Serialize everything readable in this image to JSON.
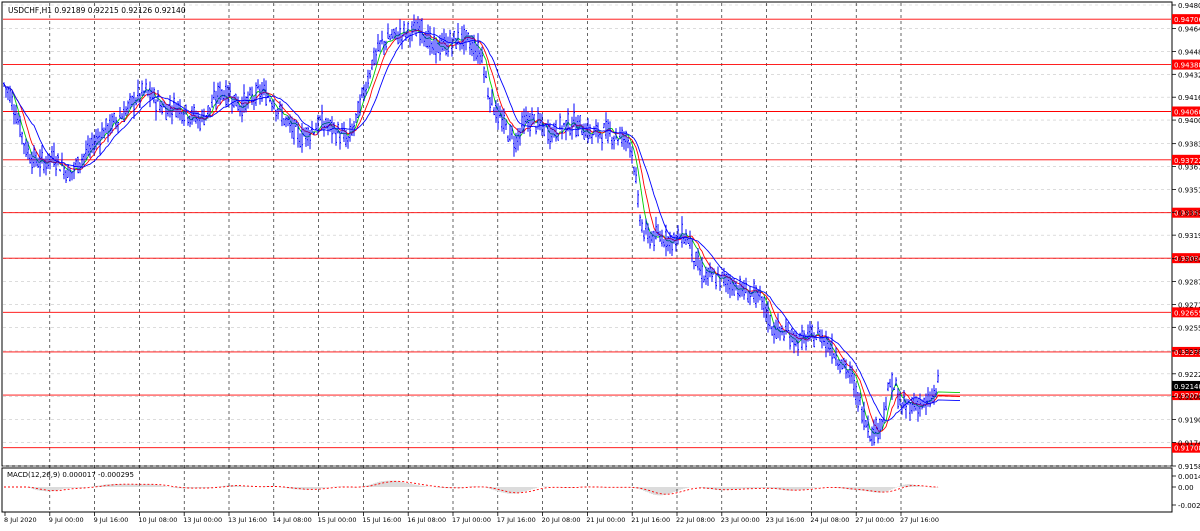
{
  "header": {
    "symbol_info": "USDCHF,H1  0.92189 0.92215 0.92126 0.92140"
  },
  "colors": {
    "bull": "#0000ff",
    "bear": "#0000ff",
    "ma_fast": "#00cc00",
    "ma_mid": "#ff0000",
    "ma_slow": "#0000ff",
    "level": "#ff0000",
    "grid": "#c8c8c8",
    "vgrid": "#000000",
    "macd_hist": "#b8b8b8",
    "macd_signal": "#ff0000"
  },
  "chart_data": {
    "type": "candlestick",
    "symbol": "USDCHF",
    "timeframe": "H1",
    "current_price": "0.92140",
    "grid": true,
    "y_range": [
      0.9158,
      0.94805
    ],
    "y_ticks": [
      "0.94805",
      "0.94640",
      "0.94480",
      "0.94320",
      "0.94160",
      "0.94000",
      "0.93835",
      "0.93675",
      "0.93515",
      "0.93355",
      "0.93195",
      "0.93030",
      "0.92870",
      "0.92710",
      "0.92550",
      "0.92385",
      "0.92225",
      "0.92065",
      "0.91905",
      "0.91745",
      "0.91580"
    ],
    "price_levels": [
      "0.94706",
      "0.94388",
      "0.94060",
      "0.93722",
      "0.93352",
      "0.93034",
      "0.92655",
      "0.92378",
      "0.92076",
      "0.91708"
    ],
    "x_labels": [
      "8 Jul 2020",
      "9 Jul 00:00",
      "9 Jul 16:00",
      "10 Jul 08:00",
      "13 Jul 00:00",
      "13 Jul 16:00",
      "14 Jul 08:00",
      "15 Jul 00:00",
      "15 Jul 16:00",
      "16 Jul 08:00",
      "17 Jul 00:00",
      "17 Jul 16:00",
      "20 Jul 08:00",
      "21 Jul 00:00",
      "21 Jul 16:00",
      "22 Jul 08:00",
      "23 Jul 00:00",
      "23 Jul 16:00",
      "24 Jul 08:00",
      "27 Jul 00:00",
      "27 Jul 16:00"
    ],
    "price_path": [
      [
        0,
        0.9425
      ],
      [
        6,
        0.9418
      ],
      [
        14,
        0.94
      ],
      [
        22,
        0.938
      ],
      [
        30,
        0.9372
      ],
      [
        40,
        0.937
      ],
      [
        50,
        0.9375
      ],
      [
        58,
        0.9368
      ],
      [
        66,
        0.9362
      ],
      [
        76,
        0.9372
      ],
      [
        86,
        0.938
      ],
      [
        96,
        0.939
      ],
      [
        108,
        0.9397
      ],
      [
        120,
        0.9405
      ],
      [
        132,
        0.9415
      ],
      [
        142,
        0.942
      ],
      [
        150,
        0.9415
      ],
      [
        160,
        0.9408
      ],
      [
        172,
        0.941
      ],
      [
        184,
        0.9405
      ],
      [
        196,
        0.94
      ],
      [
        206,
        0.9408
      ],
      [
        216,
        0.942
      ],
      [
        226,
        0.9418
      ],
      [
        236,
        0.941
      ],
      [
        248,
        0.9415
      ],
      [
        258,
        0.942
      ],
      [
        268,
        0.9415
      ],
      [
        276,
        0.9405
      ],
      [
        286,
        0.9395
      ],
      [
        296,
        0.9388
      ],
      [
        306,
        0.9392
      ],
      [
        316,
        0.9398
      ],
      [
        326,
        0.9395
      ],
      [
        336,
        0.939
      ],
      [
        344,
        0.9385
      ],
      [
        352,
        0.94
      ],
      [
        360,
        0.942
      ],
      [
        368,
        0.944
      ],
      [
        376,
        0.9452
      ],
      [
        386,
        0.9458
      ],
      [
        396,
        0.946
      ],
      [
        408,
        0.9462
      ],
      [
        418,
        0.9465
      ],
      [
        428,
        0.945
      ],
      [
        438,
        0.9452
      ],
      [
        448,
        0.9455
      ],
      [
        458,
        0.9457
      ],
      [
        468,
        0.9452
      ],
      [
        478,
        0.9445
      ],
      [
        484,
        0.942
      ],
      [
        490,
        0.941
      ],
      [
        496,
        0.94
      ],
      [
        504,
        0.9392
      ],
      [
        512,
        0.9385
      ],
      [
        520,
        0.9398
      ],
      [
        528,
        0.94
      ],
      [
        538,
        0.9395
      ],
      [
        548,
        0.9392
      ],
      [
        558,
        0.9395
      ],
      [
        568,
        0.9398
      ],
      [
        578,
        0.9395
      ],
      [
        588,
        0.939
      ],
      [
        598,
        0.9392
      ],
      [
        608,
        0.939
      ],
      [
        618,
        0.9388
      ],
      [
        626,
        0.9385
      ],
      [
        630,
        0.937
      ],
      [
        634,
        0.934
      ],
      [
        640,
        0.932
      ],
      [
        650,
        0.9318
      ],
      [
        660,
        0.9318
      ],
      [
        670,
        0.9316
      ],
      [
        680,
        0.932
      ],
      [
        686,
        0.9315
      ],
      [
        692,
        0.93
      ],
      [
        700,
        0.929
      ],
      [
        710,
        0.929
      ],
      [
        720,
        0.9288
      ],
      [
        730,
        0.9285
      ],
      [
        740,
        0.928
      ],
      [
        750,
        0.9278
      ],
      [
        760,
        0.927
      ],
      [
        768,
        0.9255
      ],
      [
        776,
        0.9252
      ],
      [
        786,
        0.925
      ],
      [
        796,
        0.9245
      ],
      [
        806,
        0.9248
      ],
      [
        816,
        0.925
      ],
      [
        826,
        0.9242
      ],
      [
        836,
        0.9232
      ],
      [
        846,
        0.9222
      ],
      [
        854,
        0.9205
      ],
      [
        862,
        0.919
      ],
      [
        868,
        0.918
      ],
      [
        874,
        0.9185
      ],
      [
        880,
        0.9195
      ],
      [
        886,
        0.9215
      ],
      [
        892,
        0.9212
      ],
      [
        898,
        0.9198
      ],
      [
        906,
        0.92
      ],
      [
        914,
        0.9202
      ],
      [
        922,
        0.92
      ],
      [
        928,
        0.9205
      ],
      [
        934,
        0.9214
      ]
    ],
    "macd": {
      "label": "MACD(12,26,9) 0.000017 -0.000295",
      "y_ticks": [
        "0.001471",
        "0.00",
        "-0.002098"
      ]
    }
  }
}
